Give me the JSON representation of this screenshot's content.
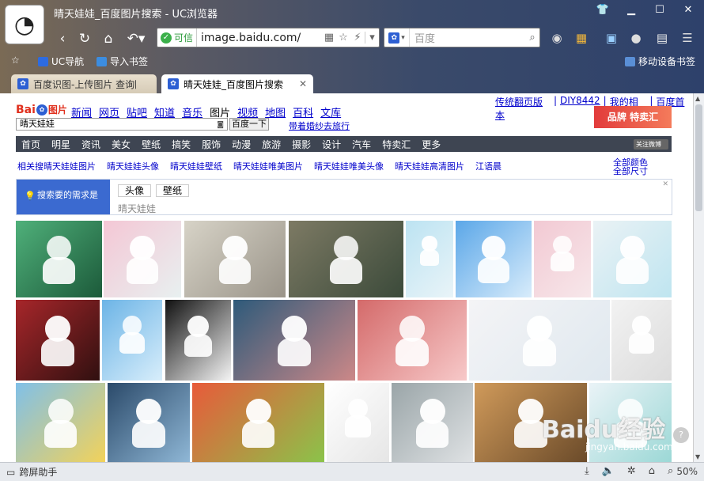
{
  "window": {
    "title": "晴天娃娃_百度图片搜索 - UC浏览器"
  },
  "toolbar": {
    "safe_label": "可信",
    "url": "image.baidu.com/",
    "search_placeholder": "百度"
  },
  "bookmarks": {
    "uc_nav": "UC导航",
    "import": "导入书签",
    "mobile": "移动设备书签"
  },
  "tabs": [
    {
      "label": "百度识图-上传图片 查询图"
    },
    {
      "label": "晴天娃娃_百度图片搜索"
    }
  ],
  "baidu": {
    "logo_text": "Bai",
    "logo_sub": "图片",
    "nav": [
      "新闻",
      "网页",
      "贴吧",
      "知道",
      "音乐",
      "图片",
      "视频",
      "地图",
      "百科",
      "文库"
    ],
    "right_links": [
      "传统翻页版本",
      "DIY8442",
      "我的相册",
      "百度首页"
    ],
    "query": "晴天娃娃",
    "search_button": "百度一下",
    "promo": "带着婚纱去旅行",
    "ad_text": "品牌 特卖汇",
    "categories": [
      "首页",
      "明星",
      "资讯",
      "美女",
      "壁纸",
      "搞笑",
      "服饰",
      "动漫",
      "旅游",
      "摄影",
      "设计",
      "汽车",
      "特卖汇",
      "更多"
    ],
    "weibo": "关注微博",
    "related_label": "相关搜",
    "related": [
      "晴天娃娃图片",
      "晴天娃娃头像",
      "晴天娃娃壁纸",
      "晴天娃娃唯美图片",
      "晴天娃娃唯美头像",
      "晴天娃娃高清图片",
      "江语晨"
    ],
    "all_sizes": "全部颜色 全部尺寸",
    "need_label": "搜索要的需求是",
    "need_chips": [
      "头像",
      "壁纸"
    ],
    "need_input": "晴天娃娃"
  },
  "watermark": {
    "text": "Baidu经验",
    "sub": "jingyan.baidu.com"
  },
  "status": {
    "helper": "跨屏助手",
    "zoom": "50%"
  }
}
